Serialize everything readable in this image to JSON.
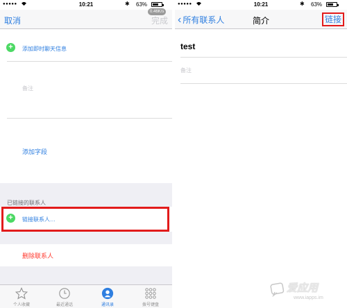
{
  "left": {
    "status": {
      "signal": "●●●●●",
      "time": "10:21",
      "battery_pct": "63%"
    },
    "nav": {
      "cancel": "取消",
      "done": "完成",
      "speed_badge": "0.46K/s"
    },
    "add_im": "添加即时聊天信息",
    "note_label": "备注",
    "add_field": "添加字段",
    "linked_header": "已链接的联系人",
    "link_contacts": "链接联系人…",
    "delete_contact": "删除联系人",
    "tabs": [
      {
        "label": "个人收藏",
        "icon": "star-icon"
      },
      {
        "label": "最近通话",
        "icon": "clock-icon"
      },
      {
        "label": "通讯录",
        "icon": "contacts-icon",
        "active": true
      },
      {
        "label": "拨号键盘",
        "icon": "keypad-icon"
      }
    ]
  },
  "right": {
    "status": {
      "signal": "●●●●●",
      "time": "10:21",
      "battery_pct": "63%"
    },
    "nav": {
      "back": "所有联系人",
      "title": "简介",
      "link": "链接"
    },
    "contact_name": "test",
    "note_label": "备注"
  },
  "watermark": {
    "brand": "爱应用",
    "url": "www.iapps.im"
  },
  "colors": {
    "accent": "#2f7fe0",
    "plus_green": "#4cd964",
    "highlight_red": "#e21b1b",
    "delete_red": "#ff3b30"
  }
}
